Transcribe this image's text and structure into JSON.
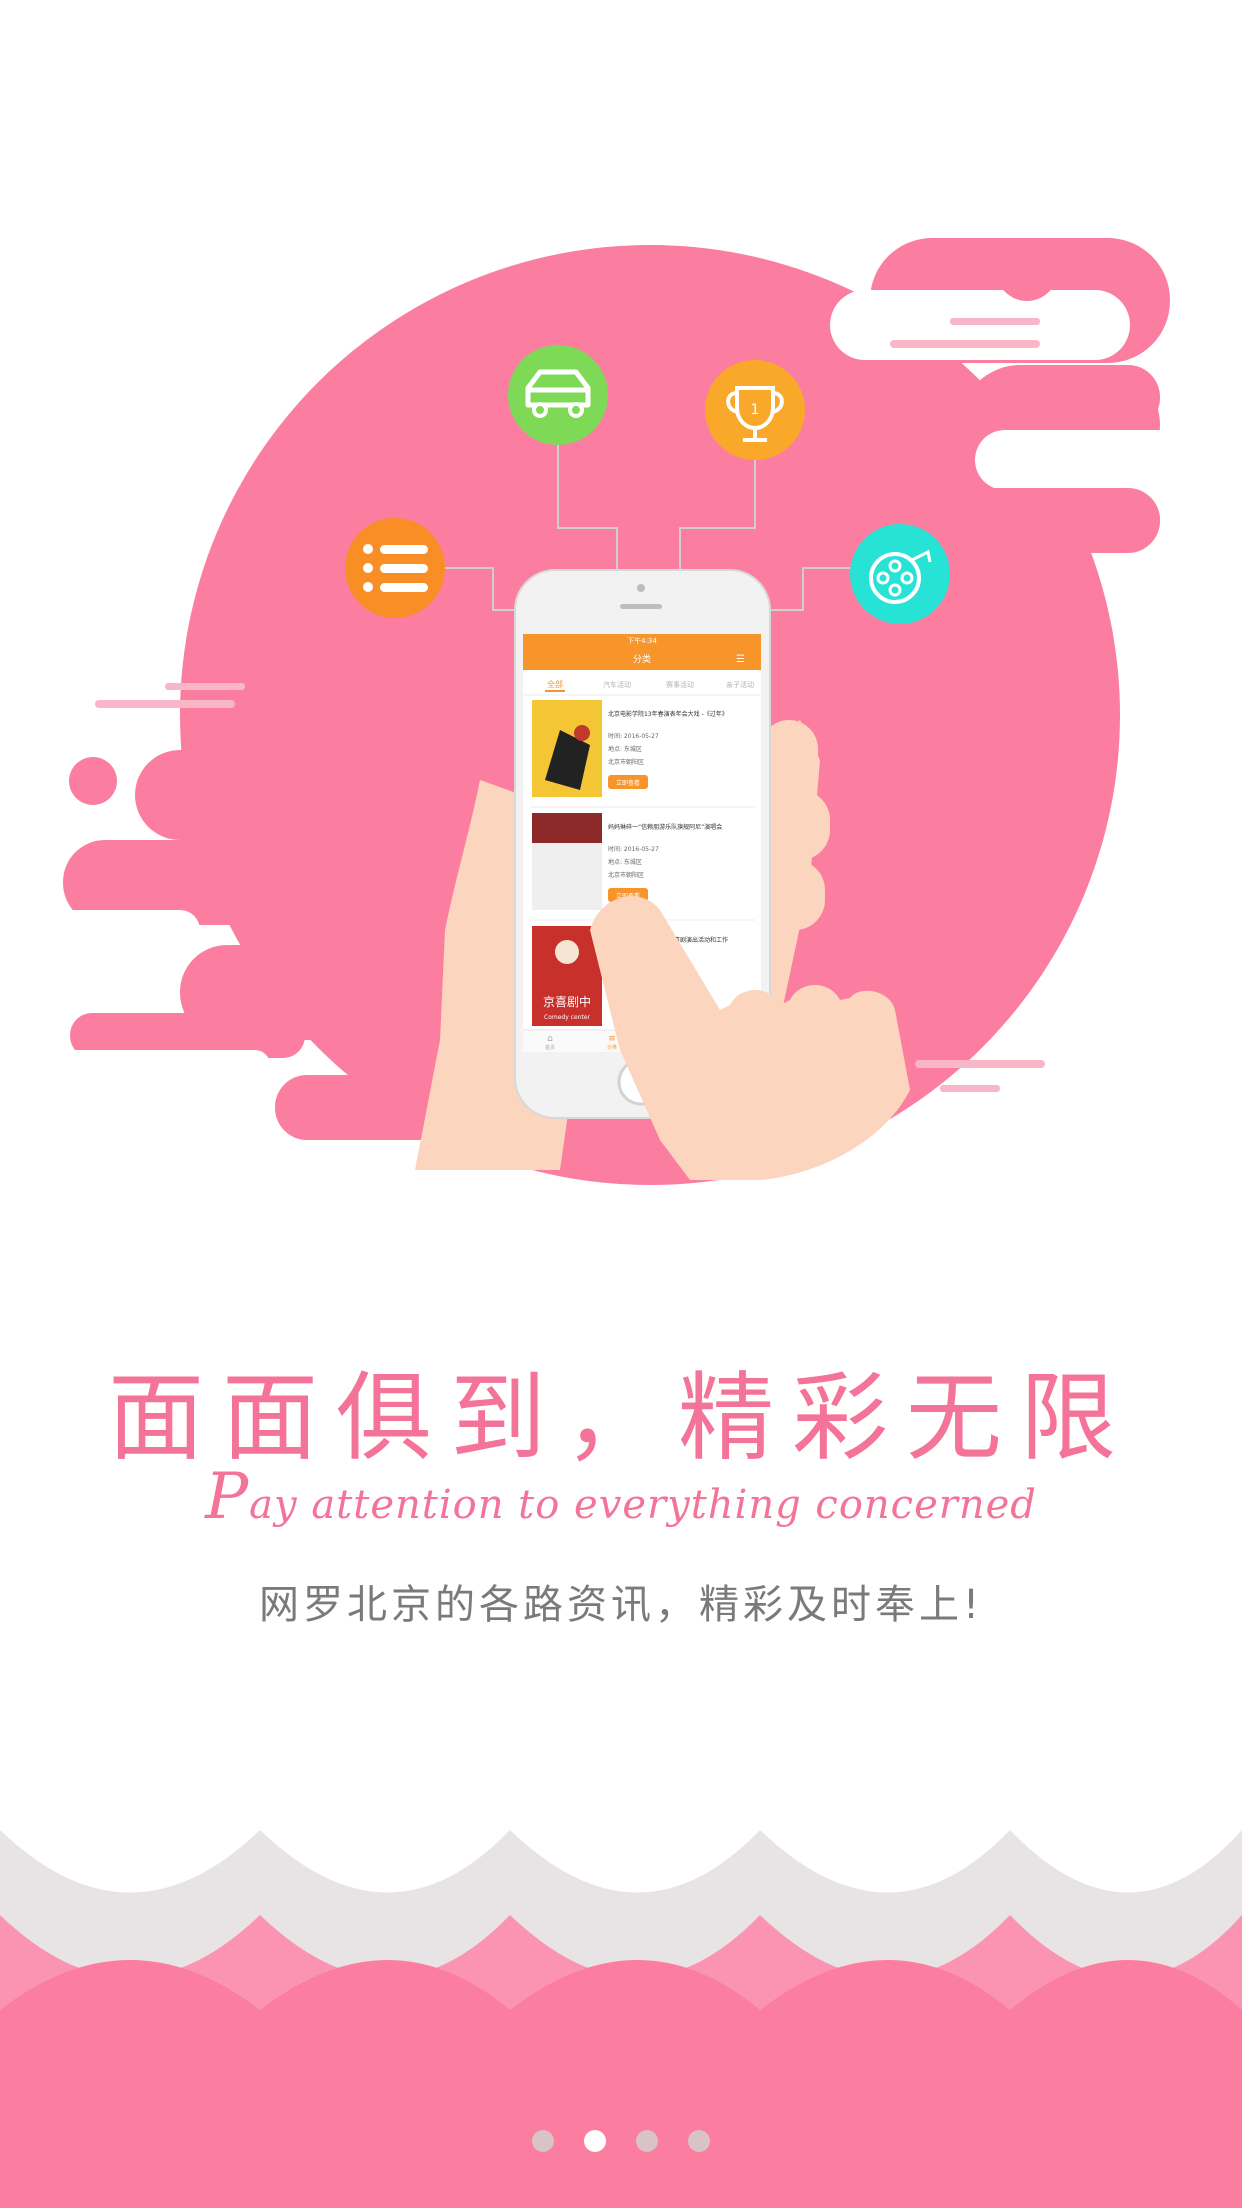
{
  "illustration": {
    "phone_app": {
      "status_time": "下午4:34",
      "nav_title": "分类",
      "tabs": [
        "全部",
        "汽车活动",
        "赛事活动",
        "亲子活动"
      ],
      "events": [
        {
          "title": "北京电影学院13年春演表年会大戏 -《过年》",
          "time": "时间: 2016-05-27",
          "place": "地点: 东城区",
          "city": "北京市朝阳区",
          "button": "立即查看"
        },
        {
          "title": "妈妈琳碎一“信赖朋游乐队旗舰阿尼”演唱会",
          "time": "时间: 2016-05-27",
          "place": "地点: 东城区",
          "city": "北京市朝阳区",
          "button": "立即查看"
        },
        {
          "title": "北京喜剧中心成立一周年喜剧演出活动和工作",
          "poster_text": "京喜剧中",
          "poster_sub": "Comedy center"
        }
      ],
      "bottom_tabs": [
        "首页",
        "分类"
      ]
    },
    "feature_icons": [
      "list-icon",
      "car-icon",
      "trophy-icon",
      "film-reel-icon"
    ],
    "colors": {
      "blob": "#fb7ea1",
      "phone_accent": "#f7942a",
      "list_icon_bg": "#f98e27",
      "car_icon_bg": "#7ed957",
      "trophy_icon_bg": "#f9a82a",
      "film_icon_bg": "#27e3d5"
    }
  },
  "headline": "面面俱到，精彩无限",
  "subline_cap": "P",
  "subline_rest": "ay attention to everything concerned",
  "tagline": "网罗北京的各路资讯，精彩及时奉上!",
  "pager": {
    "count": 4,
    "active_index": 1
  }
}
